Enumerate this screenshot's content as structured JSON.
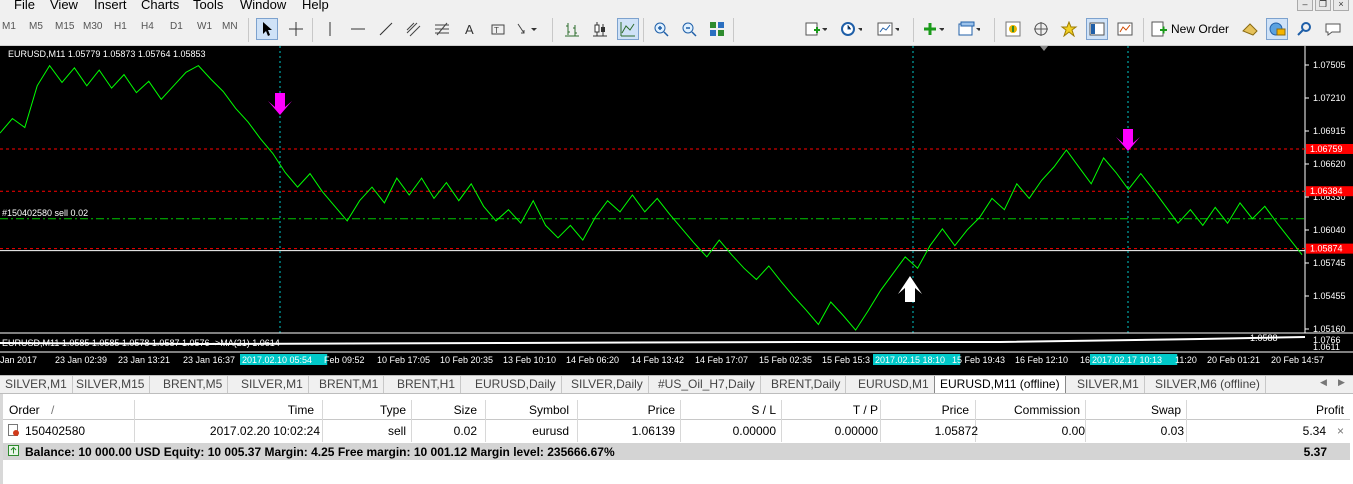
{
  "menu": [
    "File",
    "View",
    "Insert",
    "Charts",
    "Tools",
    "Window",
    "Help"
  ],
  "toolbar": {
    "timeframes": [
      "M1",
      "M5",
      "M15",
      "M30",
      "H1",
      "H4",
      "D1",
      "W1",
      "MN"
    ],
    "new_order_label": "New Order"
  },
  "chart": {
    "title": "EURUSD,M11  1.05779 1.05873 1.05764 1.05853",
    "order_label": "#150402580 sell 0.02",
    "indicator_label": "EURUSD,M11 1.0585 1.0585 1.0578 1.0587 1.0576  ->MA(21) 1.0614",
    "indicator_value_right": "1.0588",
    "indicator_axis_a": "1.0766",
    "indicator_axis_b": "1.0611",
    "price_ticks": [
      "1.07505",
      "1.07210",
      "1.06915",
      "1.06620",
      "1.06330",
      "1.06040",
      "1.05745",
      "1.05455",
      "1.05160"
    ],
    "price_markers": [
      {
        "label": "1.06759",
        "color": "#ff0000"
      },
      {
        "label": "1.06384",
        "color": "#ff0000"
      },
      {
        "label": "1.05874",
        "color": "#ff0000"
      }
    ],
    "time_labels": [
      "Jan 2017",
      "23 Jan 02:39",
      "23 Jan 13:21",
      "23 Jan 16:37",
      "2017.02.10 05:54",
      "Feb 09:52",
      "10 Feb 17:05",
      "10 Feb 20:35",
      "13 Feb 10:10",
      "14 Feb 06:20",
      "14 Feb 13:42",
      "14 Feb 17:07",
      "15 Feb 02:35",
      "15 Feb 15:3",
      "2017.02.15 18:10",
      "15 Feb 19:43",
      "16 Feb 12:10",
      "16",
      "2017.02.17 10:13",
      "11:20",
      "20 Feb 01:21",
      "20 Feb 14:57"
    ],
    "colors": {
      "line": "#00ff00",
      "sell_arrow": "#ff00ff",
      "buy_arrow": "#ffffff",
      "vline": "#00c8c8",
      "hline_red": "#ff0000",
      "hline_green": "#00c800"
    },
    "series_prices": [
      1.069,
      1.0703,
      1.0695,
      1.0732,
      1.075,
      1.0735,
      1.0748,
      1.0732,
      1.0746,
      1.073,
      1.0742,
      1.0726,
      1.0736,
      1.072,
      1.0732,
      1.0744,
      1.075,
      1.0738,
      1.0727,
      1.0712,
      1.07,
      1.0685,
      1.0672,
      1.0655,
      1.0642,
      1.0654,
      1.0638,
      1.0625,
      1.0612,
      1.063,
      1.0642,
      1.0628,
      1.065,
      1.0635,
      1.065,
      1.0632,
      1.0646,
      1.063,
      1.0645,
      1.0625,
      1.0612,
      1.0622,
      1.061,
      1.063,
      1.0608,
      1.0597,
      1.0608,
      1.0595,
      1.0615,
      1.063,
      1.062,
      1.0635,
      1.062,
      1.0632,
      1.0618,
      1.0605,
      1.0592,
      1.058,
      1.0595,
      1.0582,
      1.057,
      1.056,
      1.0572,
      1.0558,
      1.0545,
      1.0533,
      1.052,
      1.054,
      1.0528,
      1.0515,
      1.0532,
      1.055,
      1.0565,
      1.058,
      1.057,
      1.059,
      1.0605,
      1.059,
      1.0604,
      1.0615,
      1.0632,
      1.0622,
      1.0645,
      1.0632,
      1.0648,
      1.066,
      1.0675,
      1.066,
      1.0645,
      1.0668,
      1.0655,
      1.064,
      1.0654,
      1.064,
      1.0625,
      1.061,
      1.0622,
      1.0608,
      1.0624,
      1.061,
      1.0628,
      1.0614,
      1.0625,
      1.061,
      1.0596,
      1.0582
    ]
  },
  "chart_tabs": [
    "SILVER,M1",
    "SILVER,M15",
    "BRENT,M5",
    "SILVER,M1",
    "BRENT,M1",
    "BRENT,H1",
    "EURUSD,Daily",
    "SILVER,Daily",
    "#US_Oil_H7,Daily",
    "BRENT,Daily",
    "EURUSD,M1",
    "EURUSD,M11 (offline)",
    "SILVER,M1",
    "SILVER,M6 (offline)"
  ],
  "active_tab": "EURUSD,M11 (offline)",
  "terminal": {
    "columns": [
      "Order",
      "/",
      "Time",
      "Type",
      "Size",
      "Symbol",
      "Price",
      "S / L",
      "T / P",
      "Price",
      "Commission",
      "Swap",
      "Profit"
    ],
    "row": {
      "order": "150402580",
      "time": "2017.02.20 10:02:24",
      "type": "sell",
      "size": "0.02",
      "symbol": "eurusd",
      "price": "1.06139",
      "sl": "0.00000",
      "tp": "0.00000",
      "current_price": "1.05872",
      "commission": "0.00",
      "swap": "0.03",
      "profit": "5.34",
      "close": "×"
    },
    "balance_line": "Balance: 10 000.00 USD  Equity: 10 005.37  Margin: 4.25  Free margin: 10 001.12  Margin level: 235666.67%",
    "total_profit": "5.37"
  }
}
